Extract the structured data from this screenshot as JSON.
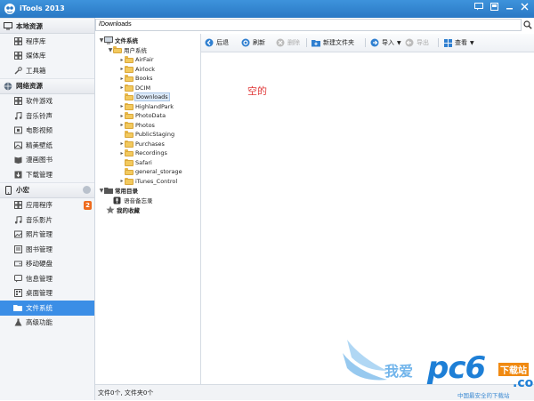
{
  "app": {
    "title": "iTools 2013"
  },
  "window_buttons": [
    "message-icon",
    "restore-icon",
    "minimize-icon",
    "close-icon"
  ],
  "sidebar": {
    "sections": [
      {
        "title": "本地资源",
        "items": [
          {
            "label": "程序库",
            "icon": "grid-icon"
          },
          {
            "label": "媒体库",
            "icon": "grid-icon"
          },
          {
            "label": "工具箱",
            "icon": "wrench-icon"
          }
        ]
      },
      {
        "title": "网络资源",
        "items": [
          {
            "label": "软件游戏",
            "icon": "grid-icon"
          },
          {
            "label": "音乐铃声",
            "icon": "music-icon"
          },
          {
            "label": "电影视频",
            "icon": "film-icon"
          },
          {
            "label": "精美壁纸",
            "icon": "picture-icon"
          },
          {
            "label": "漫画图书",
            "icon": "book-icon"
          },
          {
            "label": "下载管理",
            "icon": "download-icon"
          }
        ]
      },
      {
        "title": "小宏",
        "items": [
          {
            "label": "应用程序",
            "icon": "grid-icon",
            "badge": "2"
          },
          {
            "label": "音乐影片",
            "icon": "music-icon"
          },
          {
            "label": "照片管理",
            "icon": "photo-icon"
          },
          {
            "label": "图书管理",
            "icon": "book-icon"
          },
          {
            "label": "移动硬盘",
            "icon": "drive-icon"
          },
          {
            "label": "信息管理",
            "icon": "message-icon"
          },
          {
            "label": "桌面管理",
            "icon": "desktop-icon"
          },
          {
            "label": "文件系统",
            "icon": "folder-icon",
            "active": true
          },
          {
            "label": "高级功能",
            "icon": "advanced-icon"
          }
        ]
      }
    ]
  },
  "path": {
    "value": "/Downloads"
  },
  "tree": {
    "root": "文件系统",
    "user": "用户系统",
    "folders": [
      "AirFair",
      "Airlock",
      "Books",
      "DCIM",
      "Downloads",
      "HighlandPark",
      "PhotoData",
      "Photos",
      "PublicStaging",
      "Purchases",
      "Recordings",
      "Safari",
      "general_storage",
      "iTunes_Control"
    ],
    "selected": "Downloads",
    "common": "常用目录",
    "common_child": "语音备忘录",
    "favorites": "我的收藏"
  },
  "toolbar": {
    "back": "后退",
    "refresh": "刷新",
    "delete": "删除",
    "new_folder": "新建文件夹",
    "import": "导入",
    "export": "导出",
    "view": "查看"
  },
  "content": {
    "empty_text": "空的"
  },
  "status": {
    "text": "文件0个, 文件夹0个"
  },
  "watermark": {
    "slogan": "我爱",
    "brand": "pc6",
    "tag": "下载站",
    "domain": ".com",
    "caption": "中国最安全的下载站"
  },
  "colors": {
    "titlebar": "#2a78c4",
    "active_item": "#3b8ee6",
    "badge": "#ee6b1e",
    "empty_text": "#e03a3a"
  }
}
